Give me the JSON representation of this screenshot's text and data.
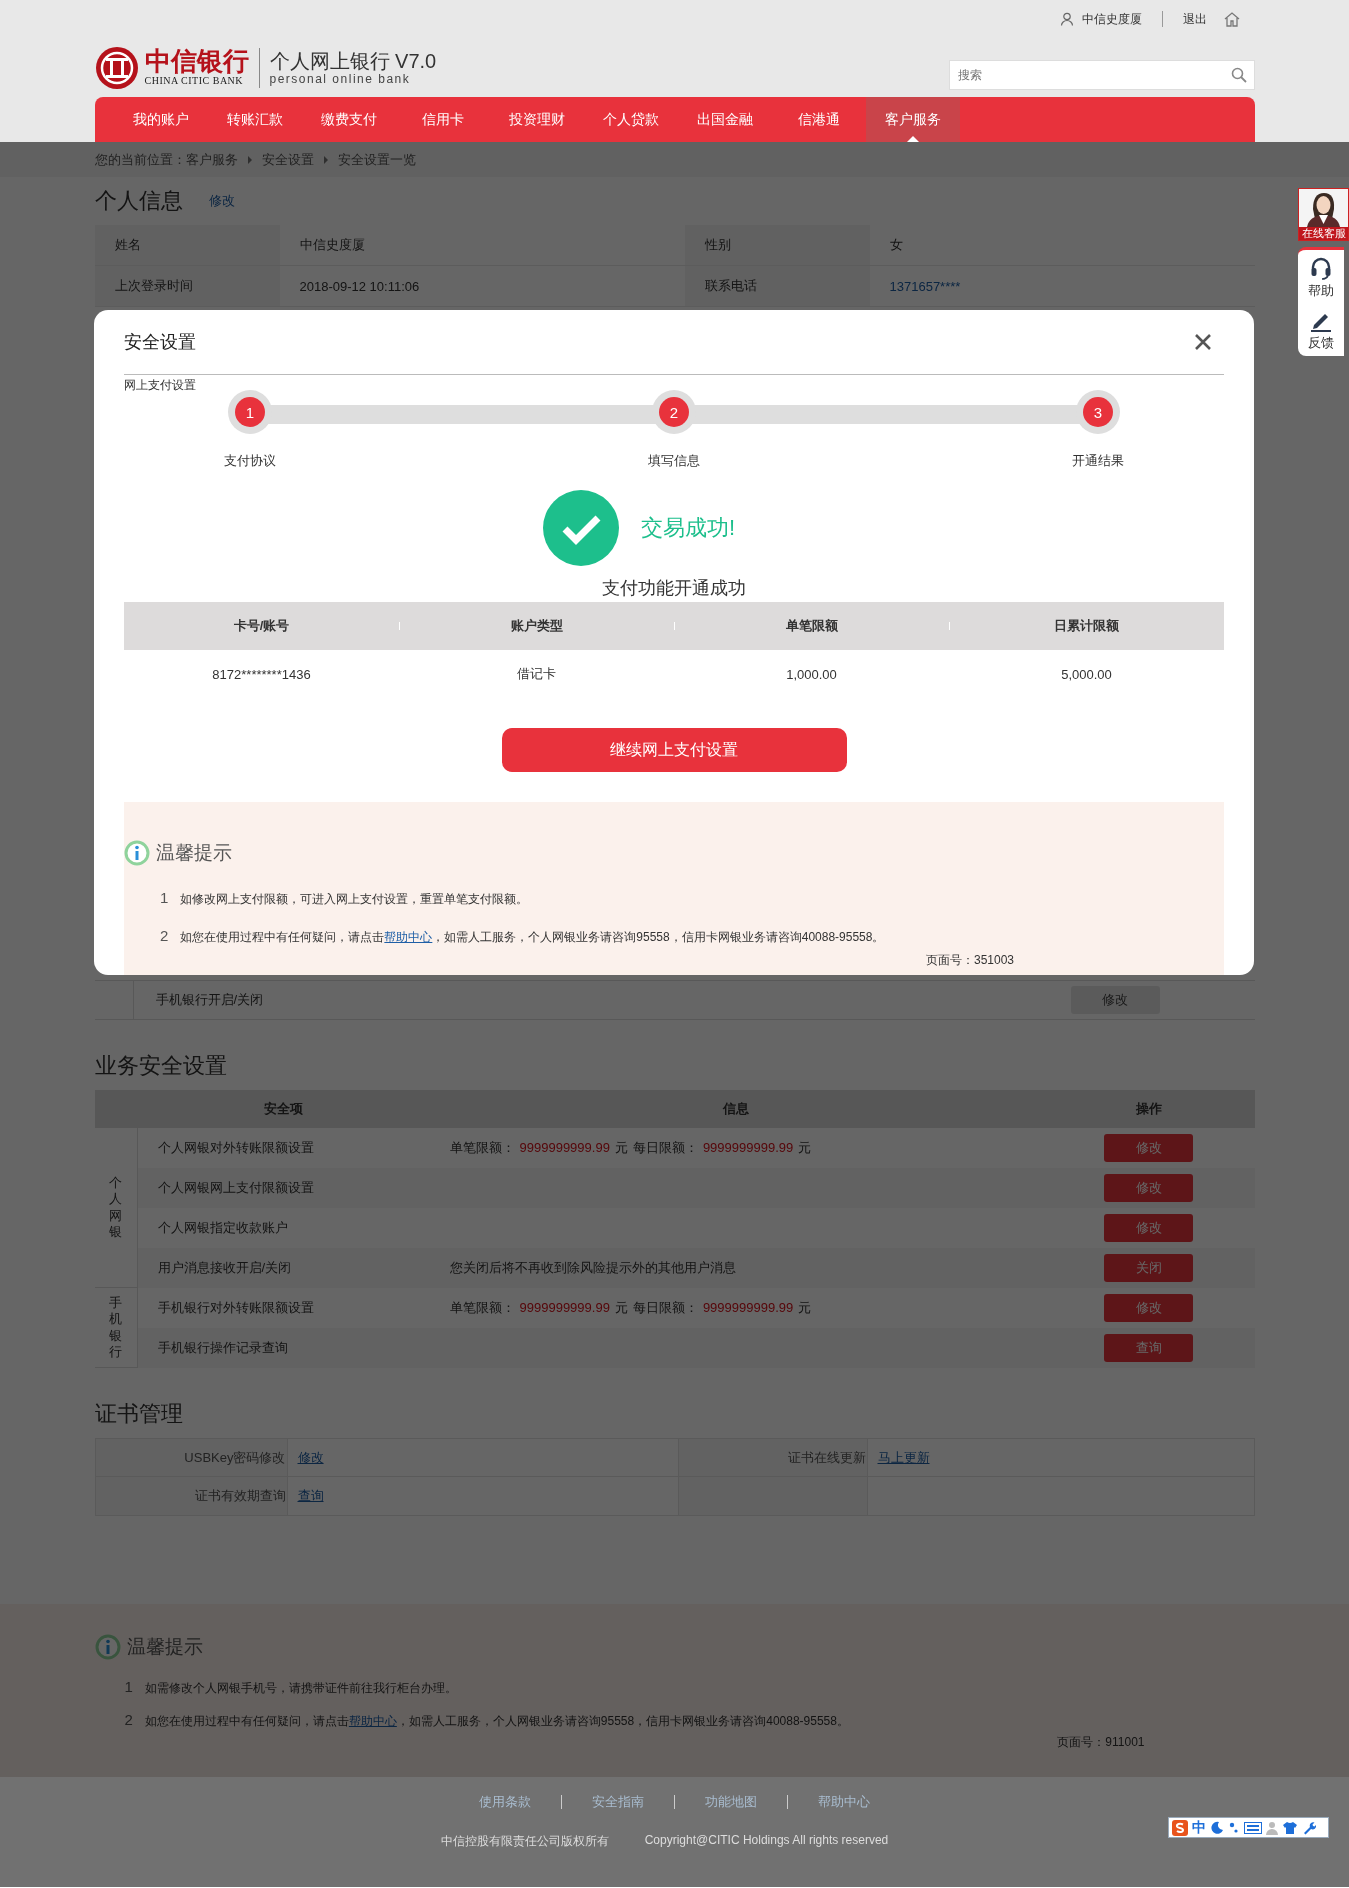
{
  "header": {
    "user": "中信史度厦",
    "logout": "退出",
    "logo_cn": "中信银行",
    "logo_en": "CHINA CITIC BANK",
    "product": "个人网上银行 V7.0",
    "product_en": "personal online bank",
    "search": {
      "placeholder": "搜索"
    }
  },
  "nav": [
    {
      "label": "我的账户",
      "selected": false
    },
    {
      "label": "转账汇款",
      "selected": false
    },
    {
      "label": "缴费支付",
      "selected": false
    },
    {
      "label": "信用卡",
      "selected": false
    },
    {
      "label": "投资理财",
      "selected": false
    },
    {
      "label": "个人贷款",
      "selected": false
    },
    {
      "label": "出国金融",
      "selected": false
    },
    {
      "label": "信港通",
      "selected": false
    },
    {
      "label": "客户服务",
      "selected": true
    }
  ],
  "breadcrumb": [
    "您的当前位置：客户服务",
    "安全设置",
    "安全设置一览"
  ],
  "personal_info": {
    "title": "个人信息",
    "edit": "修改",
    "rows": [
      [
        "姓名",
        "中信史度厦",
        "性别",
        "女"
      ],
      [
        "上次登录时间",
        "2018-09-12 10:11:06",
        "联系电话",
        "1371657****"
      ]
    ]
  },
  "account_row": {
    "item": "手机银行开启/关闭",
    "button": {
      "label": "修改",
      "disabled": true
    }
  },
  "business_security": {
    "title": "业务安全设置",
    "columns": [
      "安全项",
      "信息",
      "操作"
    ],
    "groups": [
      {
        "label": "个人网银",
        "rows": [
          {
            "item": "个人网银对外转账限额设置",
            "info": [
              {
                "text": "单笔限额：",
                "highlight": false
              },
              {
                "text": "9999999999.99",
                "highlight": true
              },
              {
                "text": "元",
                "highlight": false
              },
              {
                "text": "每日限额：",
                "highlight": false
              },
              {
                "text": "9999999999.99",
                "highlight": true
              },
              {
                "text": "元",
                "highlight": false
              }
            ],
            "button": {
              "label": "修改",
              "disabled": false
            }
          },
          {
            "item": "个人网银网上支付限额设置",
            "button": {
              "label": "修改",
              "disabled": false
            }
          },
          {
            "item": "个人网银指定收款账户",
            "button": {
              "label": "修改",
              "disabled": false
            }
          },
          {
            "item": "用户消息接收开启/关闭",
            "info": [
              {
                "text": "您关闭后将不再收到除风险提示外的其他用户消息",
                "highlight": false
              }
            ],
            "button": {
              "label": "关闭",
              "disabled": false
            }
          }
        ]
      },
      {
        "label": "手机银行",
        "rows": [
          {
            "item": "手机银行对外转账限额设置",
            "info": [
              {
                "text": "单笔限额：",
                "highlight": false
              },
              {
                "text": "9999999999.99",
                "highlight": true
              },
              {
                "text": "元",
                "highlight": false
              },
              {
                "text": "每日限额：",
                "highlight": false
              },
              {
                "text": "9999999999.99",
                "highlight": true
              },
              {
                "text": "元",
                "highlight": false
              }
            ],
            "button": {
              "label": "修改",
              "disabled": false
            }
          },
          {
            "item": "手机银行操作记录查询",
            "button": {
              "label": "查询",
              "disabled": false
            }
          }
        ]
      }
    ]
  },
  "certificates": {
    "title": "证书管理",
    "rows": [
      [
        {
          "label": "USBKey密码修改",
          "link": "修改"
        },
        {
          "label": "证书在线更新",
          "link": "马上更新"
        }
      ],
      [
        {
          "label": "证书有效期查询",
          "link": "查询"
        }
      ]
    ]
  },
  "tips": {
    "title": "温馨提示",
    "items": [
      {
        "number": "1",
        "text": "如需修改个人网银手机号，请携带证件前往我行柜台办理。"
      },
      {
        "number": "2",
        "text": "如您在使用过程中有任何疑问，请点击",
        "link": "帮助中心",
        "after": "，如需人工服务，个人网银业务请咨询95558，信用卡网银业务请咨询40088-95558。"
      }
    ],
    "page_no": "页面号：911001"
  },
  "footer": {
    "links": [
      "使用条款",
      "安全指南",
      "功能地图",
      "帮助中心"
    ],
    "company": "中信控股有限责任公司版权所有",
    "copyright": "Copyright@CITIC Holdings All rights reserved"
  },
  "modal": {
    "title": "安全设置",
    "subtitle": "网上支付设置",
    "steps": [
      {
        "number": "1",
        "label": "支付协议"
      },
      {
        "number": "2",
        "label": "填写信息"
      },
      {
        "number": "3",
        "label": "开通结果"
      }
    ],
    "result": "交易成功!",
    "message": "支付功能开通成功",
    "table": {
      "columns": [
        "卡号/账号",
        "账户类型",
        "单笔限额",
        "日累计限额"
      ],
      "rows": [
        [
          "8172********1436",
          "借记卡",
          "1,000.00",
          "5,000.00"
        ]
      ]
    },
    "button": "继续网上支付设置",
    "tips": {
      "title": "温馨提示",
      "items": [
        {
          "number": "1",
          "text": "如修改网上支付限额，可进入网上支付设置，重置单笔支付限额。"
        },
        {
          "number": "2",
          "text": "如您在使用过程中有任何疑问，请点击",
          "link": "帮助中心",
          "after": "，如需人工服务，个人网银业务请咨询95558，信用卡网银业务请咨询40088-95558。"
        }
      ],
      "page_no": "页面号：351003"
    }
  },
  "float_widget": {
    "avatar_caption": "在线客服",
    "items": [
      {
        "kind": "help",
        "label": "帮助"
      },
      {
        "kind": "feedback",
        "label": "反馈"
      }
    ]
  },
  "ime_toolbar": {
    "label": "中"
  }
}
